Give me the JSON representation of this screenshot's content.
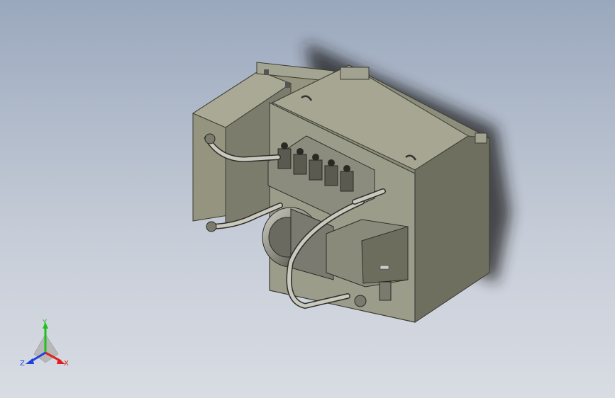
{
  "viewport": {
    "background_top": "#9aa8bd",
    "background_bottom": "#d8dce3",
    "model_color": "#8a8a7c",
    "hose_color": "#c9c9c0"
  },
  "triad": {
    "x_label": "X",
    "y_label": "Y",
    "z_label": "Z",
    "x_color": "#e02020",
    "y_color": "#20c020",
    "z_color": "#2040e0"
  }
}
